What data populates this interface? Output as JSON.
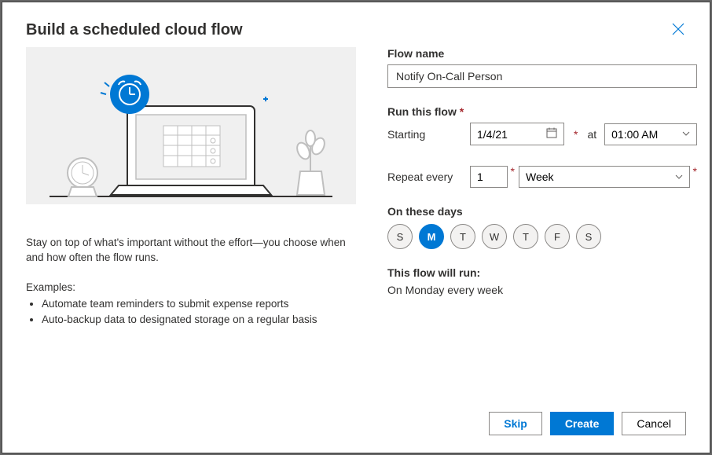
{
  "title": "Build a scheduled cloud flow",
  "description": "Stay on top of what's important without the effort—you choose when and how often the flow runs.",
  "examplesLabel": "Examples:",
  "examples": [
    "Automate team reminders to submit expense reports",
    "Auto-backup data to designated storage on a regular basis"
  ],
  "labels": {
    "flowName": "Flow name",
    "runThisFlow": "Run this flow",
    "starting": "Starting",
    "at": "at",
    "repeatEvery": "Repeat every",
    "onTheseDays": "On these days",
    "thisFlowWillRun": "This flow will run:"
  },
  "values": {
    "flowName": "Notify On-Call Person",
    "startDate": "1/4/21",
    "startTime": "01:00 AM",
    "repeatCount": "1",
    "repeatUnit": "Week",
    "summary": "On Monday every week"
  },
  "days": [
    {
      "label": "S",
      "selected": false
    },
    {
      "label": "M",
      "selected": true
    },
    {
      "label": "T",
      "selected": false
    },
    {
      "label": "W",
      "selected": false
    },
    {
      "label": "T",
      "selected": false
    },
    {
      "label": "F",
      "selected": false
    },
    {
      "label": "S",
      "selected": false
    }
  ],
  "buttons": {
    "skip": "Skip",
    "create": "Create",
    "cancel": "Cancel"
  }
}
